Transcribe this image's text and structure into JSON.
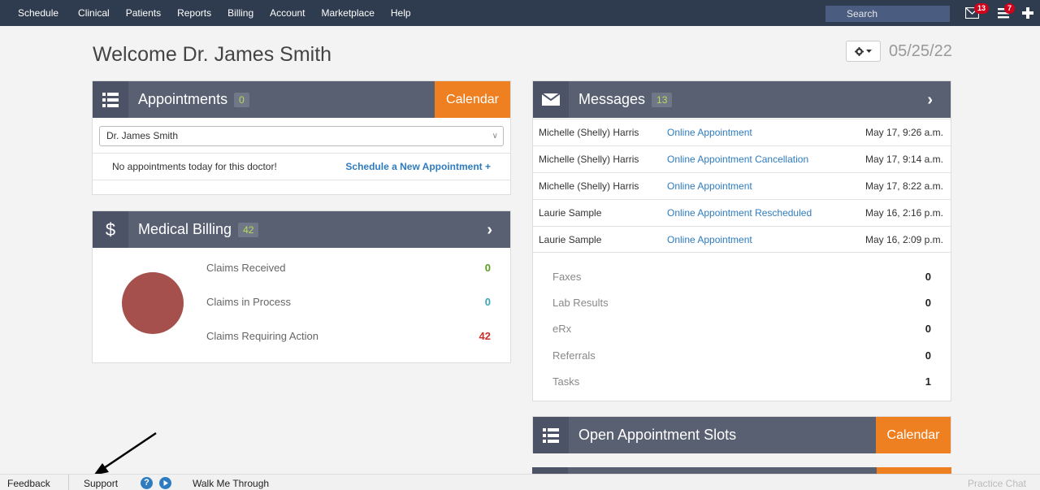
{
  "nav": {
    "items": [
      "Schedule",
      "Clinical",
      "Patients",
      "Reports",
      "Billing",
      "Account",
      "Marketplace",
      "Help"
    ],
    "search_placeholder": "Search",
    "mail_badge": "13",
    "tasks_badge": "7"
  },
  "welcome": "Welcome Dr. James Smith",
  "date": "05/25/22",
  "appointments": {
    "title": "Appointments",
    "count": "0",
    "calendar_label": "Calendar",
    "doctor": "Dr. James Smith",
    "empty_text": "No appointments today for this doctor!",
    "new_link": "Schedule a New Appointment +"
  },
  "billing": {
    "title": "Medical Billing",
    "count": "42",
    "claims": [
      {
        "label": "Claims Received",
        "value": "0",
        "color": "#5c9e1f"
      },
      {
        "label": "Claims in Process",
        "value": "0",
        "color": "#39a5b7"
      },
      {
        "label": "Claims Requiring Action",
        "value": "42",
        "color": "#c9302c"
      }
    ]
  },
  "messages": {
    "title": "Messages",
    "count": "13",
    "rows": [
      {
        "from": "Michelle (Shelly) Harris",
        "subject": "Online Appointment",
        "time": "May 17, 9:26 a.m."
      },
      {
        "from": "Michelle (Shelly) Harris",
        "subject": "Online Appointment Cancellation",
        "time": "May 17, 9:14 a.m."
      },
      {
        "from": "Michelle (Shelly) Harris",
        "subject": "Online Appointment",
        "time": "May 17, 8:22 a.m."
      },
      {
        "from": "Laurie Sample",
        "subject": "Online Appointment Rescheduled",
        "time": "May 16, 2:16 p.m."
      },
      {
        "from": "Laurie Sample",
        "subject": "Online Appointment",
        "time": "May 16, 2:09 p.m."
      }
    ],
    "stats": [
      {
        "label": "Faxes",
        "value": "0"
      },
      {
        "label": "Lab Results",
        "value": "0"
      },
      {
        "label": "eRx",
        "value": "0"
      },
      {
        "label": "Referrals",
        "value": "0"
      },
      {
        "label": "Tasks",
        "value": "1"
      }
    ]
  },
  "slots": {
    "title": "Open Appointment Slots",
    "calendar_label": "Calendar"
  },
  "footer": {
    "feedback": "Feedback",
    "support": "Support",
    "walk": "Walk Me Through",
    "chat": "Practice Chat"
  },
  "colors": {
    "nav_bg": "#2f3b4e",
    "panel_header": "#596072",
    "orange": "#ef8021",
    "link_blue": "#2e7cbf"
  }
}
